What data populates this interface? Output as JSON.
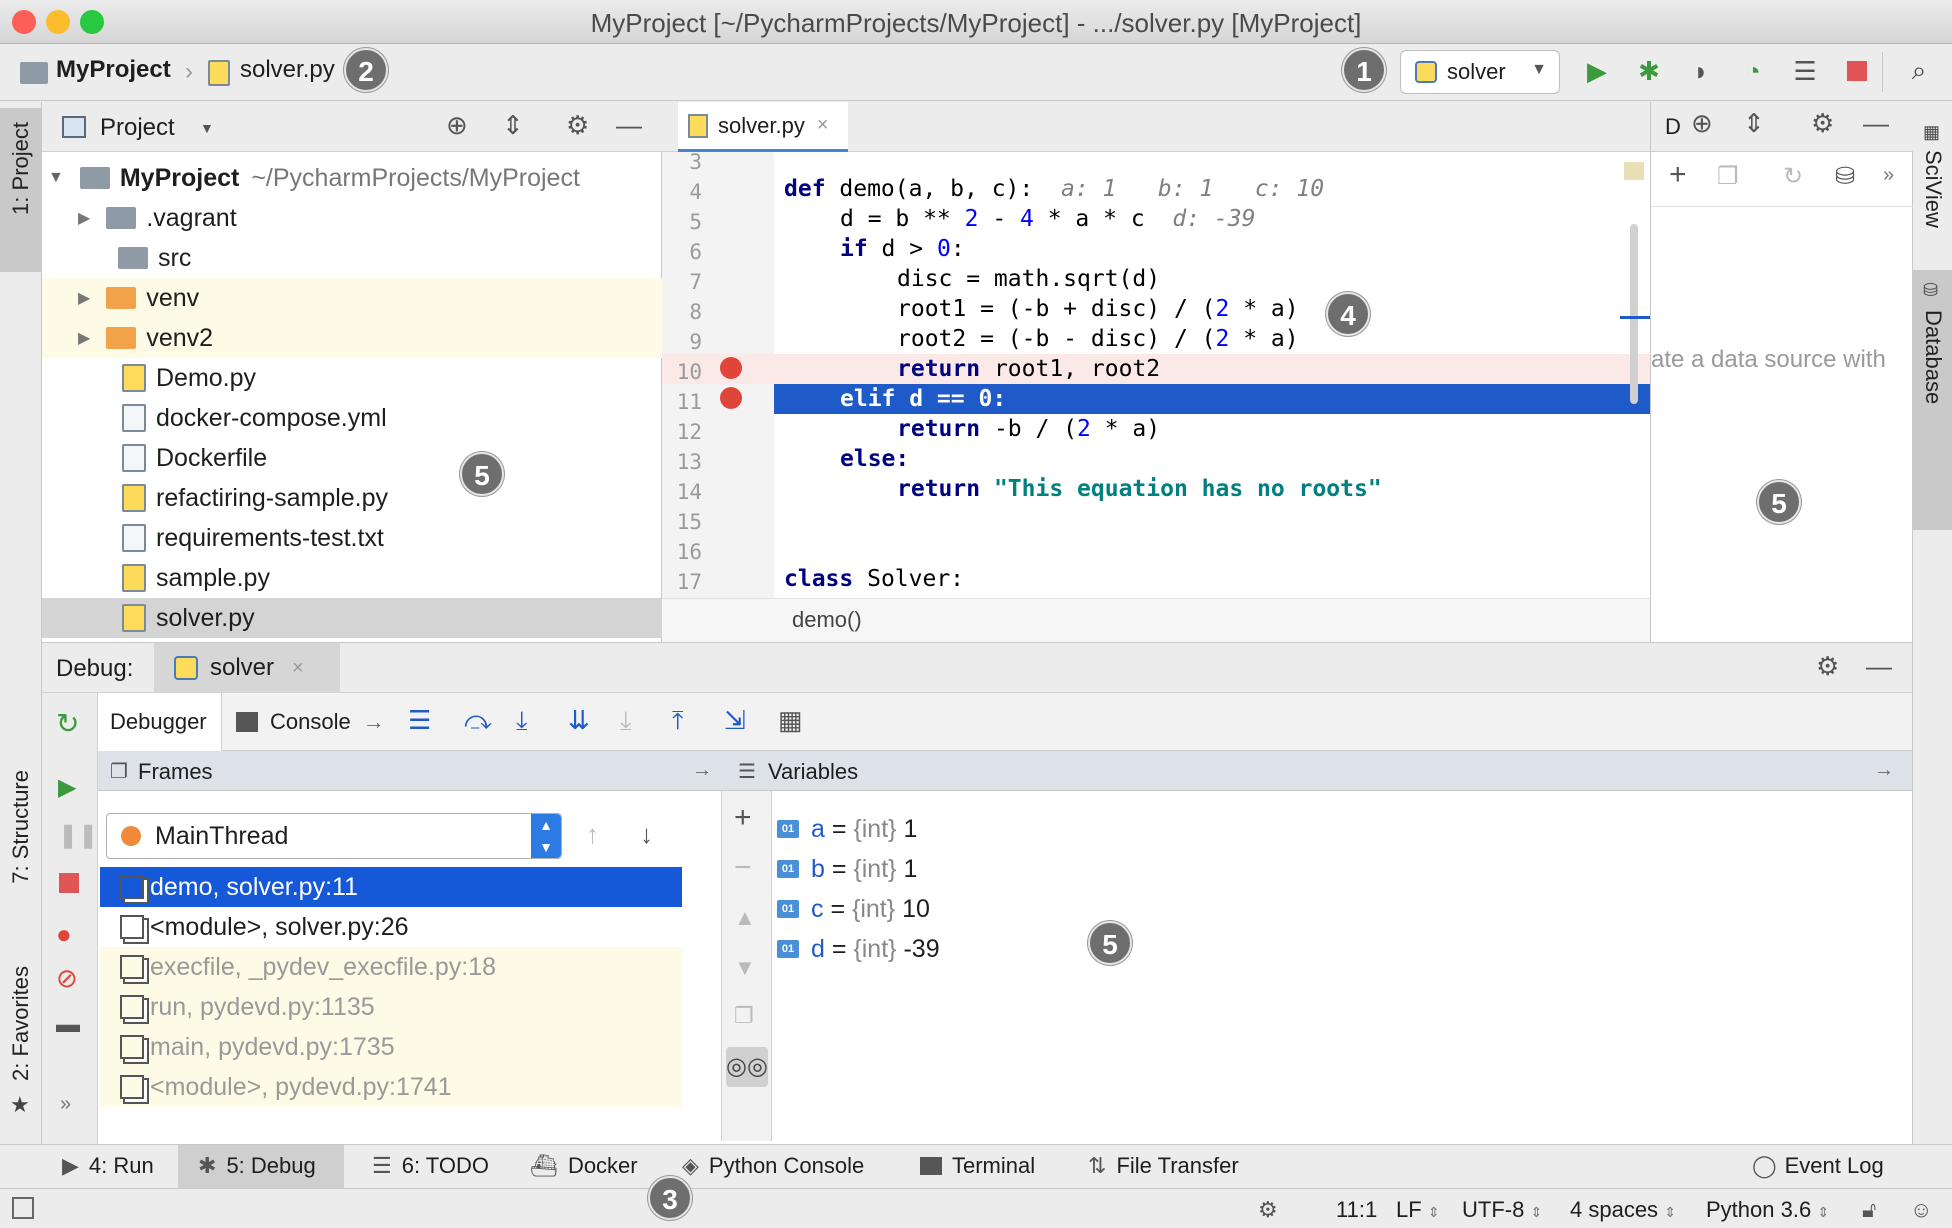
{
  "window": {
    "title": "MyProject [~/PycharmProjects/MyProject] - .../solver.py [MyProject]"
  },
  "navbar": {
    "project": "MyProject",
    "file": "solver.py",
    "run_config": "solver"
  },
  "callouts": {
    "one": "1",
    "two": "2",
    "three": "3",
    "four": "4",
    "five": "5"
  },
  "side_left": {
    "project": "1: Project",
    "structure": "7: Structure",
    "favorites": "2: Favorites"
  },
  "side_right": {
    "sciview": "SciView",
    "database": "Database"
  },
  "project_panel": {
    "title": "Project",
    "root_name": "MyProject",
    "root_path": "~/PycharmProjects/MyProject",
    "items": [
      {
        "label": ".vagrant"
      },
      {
        "label": "src"
      },
      {
        "label": "venv"
      },
      {
        "label": "venv2"
      },
      {
        "label": "Demo.py"
      },
      {
        "label": "docker-compose.yml"
      },
      {
        "label": "Dockerfile"
      },
      {
        "label": "refactiring-sample.py"
      },
      {
        "label": "requirements-test.txt"
      },
      {
        "label": "sample.py"
      },
      {
        "label": "solver.py"
      }
    ]
  },
  "editor": {
    "tab": "solver.py",
    "breadcrumb": "demo()",
    "lines": [
      "3",
      "4",
      "5",
      "6",
      "7",
      "8",
      "9",
      "10",
      "11",
      "12",
      "13",
      "14",
      "15",
      "16",
      "17"
    ],
    "hints": {
      "l4": "a: 1   b: 1   c: 10",
      "l5": "d: -39"
    },
    "code": {
      "def": "def",
      "sig": " demo(a, b, c):",
      "l5a": "d = b ** ",
      "two": "2",
      "minus": " - ",
      "four": "4",
      "l5b": " * a * c",
      "l6kw": "if",
      "l6a": " d > ",
      "zero": "0",
      "colon": ":",
      "l7": "disc = math.sqrt(d)",
      "l8a": "root1 = (-b + disc) / (",
      "l8b": " * a)",
      "l9a": "root2 = (-b - disc) / (",
      "ret": "return",
      "l10": " root1, root2",
      "l11": "elif d == 0:",
      "l12a": " -b / (",
      "else": "else:",
      "str14": "\"This equation has no roots\"",
      "class": "class",
      "l17": " Solver:"
    }
  },
  "right_panel": {
    "title": "D",
    "hint": "ate a data source with"
  },
  "debug": {
    "label": "Debug:",
    "session": "solver",
    "tabs": {
      "debugger": "Debugger",
      "console": "Console"
    },
    "frames_title": "Frames",
    "variables_title": "Variables",
    "thread": "MainThread",
    "frames": [
      {
        "label": "demo, solver.py:11"
      },
      {
        "label": "<module>, solver.py:26"
      },
      {
        "label": "execfile, _pydev_execfile.py:18"
      },
      {
        "label": "run, pydevd.py:1135"
      },
      {
        "label": "main, pydevd.py:1735"
      },
      {
        "label": "<module>, pydevd.py:1741"
      }
    ],
    "variables": [
      {
        "name": "a",
        "type": "{int}",
        "value": "1"
      },
      {
        "name": "b",
        "type": "{int}",
        "value": "1"
      },
      {
        "name": "c",
        "type": "{int}",
        "value": "10"
      },
      {
        "name": "d",
        "type": "{int}",
        "value": "-39"
      }
    ]
  },
  "tool_windows": {
    "run": "4: Run",
    "debug": "5: Debug",
    "todo": "6: TODO",
    "docker": "Docker",
    "python_console": "Python Console",
    "terminal": "Terminal",
    "file_transfer": "File Transfer",
    "event_log": "Event Log"
  },
  "status": {
    "position": "11:1",
    "line_sep": "LF",
    "encoding": "UTF-8",
    "indent": "4 spaces",
    "interpreter": "Python 3.6"
  },
  "colors": {
    "accent": "#1f5bc8",
    "run": "#3b9a3b",
    "stop": "#e05555",
    "breakpoint": "#e0453a"
  }
}
